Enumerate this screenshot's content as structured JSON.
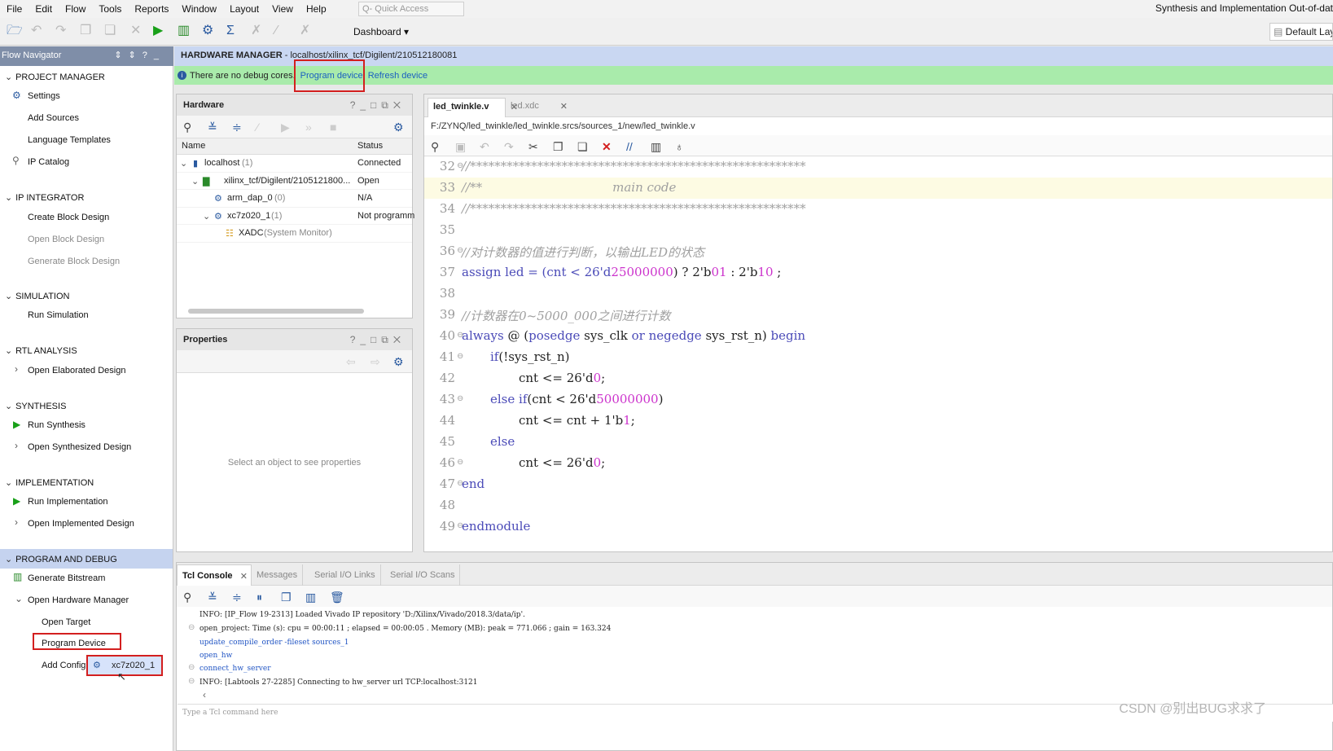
{
  "menu": [
    "File",
    "Edit",
    "Flow",
    "Tools",
    "Reports",
    "Window",
    "Layout",
    "View",
    "Help"
  ],
  "quick_access": "Q- Quick Access",
  "app_title": "Synthesis and Implementation Out-of-dat",
  "toolbar": {
    "dashboard": "Dashboard",
    "default_layout": "Default Lay"
  },
  "flow_nav": {
    "title": "Flow Navigator",
    "project_manager": "PROJECT MANAGER",
    "pm_items": [
      "Settings",
      "Add Sources",
      "Language Templates",
      "IP Catalog"
    ],
    "ip_integrator": "IP INTEGRATOR",
    "ipi_items": [
      "Create Block Design",
      "Open Block Design",
      "Generate Block Design"
    ],
    "simulation": "SIMULATION",
    "sim_items": [
      "Run Simulation"
    ],
    "rtl": "RTL ANALYSIS",
    "rtl_items": [
      "Open Elaborated Design"
    ],
    "synthesis": "SYNTHESIS",
    "syn_items": [
      "Run Synthesis",
      "Open Synthesized Design"
    ],
    "implementation": "IMPLEMENTATION",
    "impl_items": [
      "Run Implementation",
      "Open Implemented Design"
    ],
    "program_debug": "PROGRAM AND DEBUG",
    "pd_items": [
      "Generate Bitstream",
      "Open Hardware Manager",
      "Open Target",
      "Program Device",
      "Add Config"
    ],
    "popup": "xc7z020_1"
  },
  "hm": {
    "title": "HARDWARE MANAGER",
    "path": " - localhost/xilinx_tcf/Digilent/210512180081",
    "banner": "There are no debug cores.",
    "program": "Program device",
    "refresh": "Refresh device"
  },
  "hardware": {
    "title": "Hardware",
    "cols": [
      "Name",
      "Status"
    ],
    "rows": [
      {
        "name": "localhost",
        "count": "(1)",
        "status": "Connected"
      },
      {
        "name": "xilinx_tcf/Digilent/2105121800...",
        "count": "",
        "status": "Open"
      },
      {
        "name": "arm_dap_0",
        "count": "(0)",
        "status": "N/A"
      },
      {
        "name": "xc7z020_1",
        "count": "(1)",
        "status": "Not programm"
      },
      {
        "name": "XADC",
        "count": "(System Monitor)",
        "status": ""
      }
    ]
  },
  "properties": {
    "title": "Properties",
    "empty": "Select an object to see properties"
  },
  "editor": {
    "tabs": [
      "led_twinkle.v",
      "led.xdc"
    ],
    "path": "F:/ZYNQ/led_twinkle/led_twinkle.srcs/sources_1/new/led_twinkle.v",
    "line_numbers": [
      "32",
      "33",
      "34",
      "35",
      "36",
      "37",
      "38",
      "39",
      "40",
      "41",
      "42",
      "43",
      "44",
      "45",
      "46",
      "47",
      "48",
      "49"
    ],
    "code": {
      "l32": "//*******************************************************",
      "l33a": "//**",
      "l33b": "main code",
      "l34": "//*******************************************************",
      "l36": "//对计数器的值进行判断，以输出LED的状态",
      "l37a": "assign led = (cnt < 26'd",
      "l37b": "25000000",
      "l37c": ") ? 2'b",
      "l37d": "01",
      "l37e": " : 2'b",
      "l37f": "10",
      "l37g": " ;",
      "l39": "//计数器在0~5000_000之间进行计数",
      "l40a": "always",
      "l40b": " @ (",
      "l40c": "posedge",
      "l40d": " sys_clk ",
      "l40e": "or",
      "l40f": " ",
      "l40g": "negedge",
      "l40h": " sys_rst_n) ",
      "l40i": "begin",
      "l41a": "if",
      "l41b": "(!sys_rst_n)",
      "l42a": "cnt <= 26'd",
      "l42b": "0",
      "l42c": ";",
      "l43a": "else if",
      "l43b": "(cnt < 26'd",
      "l43c": "50000000",
      "l43d": ")",
      "l44a": "cnt <= cnt + 1'b",
      "l44b": "1",
      "l44c": ";",
      "l45": "else",
      "l46a": "cnt <= 26'd",
      "l46b": "0",
      "l46c": ";",
      "l47": "end",
      "l49": "endmodule"
    }
  },
  "console": {
    "tabs": [
      "Tcl Console",
      "Messages",
      "Serial I/O Links",
      "Serial I/O Scans"
    ],
    "lines": [
      "INFO: [IP_Flow 19-2313] Loaded Vivado IP repository 'D:/Xilinx/Vivado/2018.3/data/ip'.",
      "open_project: Time (s): cpu = 00:00:11 ; elapsed = 00:00:05 . Memory (MB): peak = 771.066 ; gain = 163.324",
      "update_compile_order -fileset sources_1",
      "open_hw",
      "connect_hw_server",
      "INFO: [Labtools 27-2285] Connecting to hw_server url TCP:localhost:3121"
    ],
    "placeholder": "Type a Tcl command here"
  },
  "watermark": "CSDN @别出BUG求求了"
}
